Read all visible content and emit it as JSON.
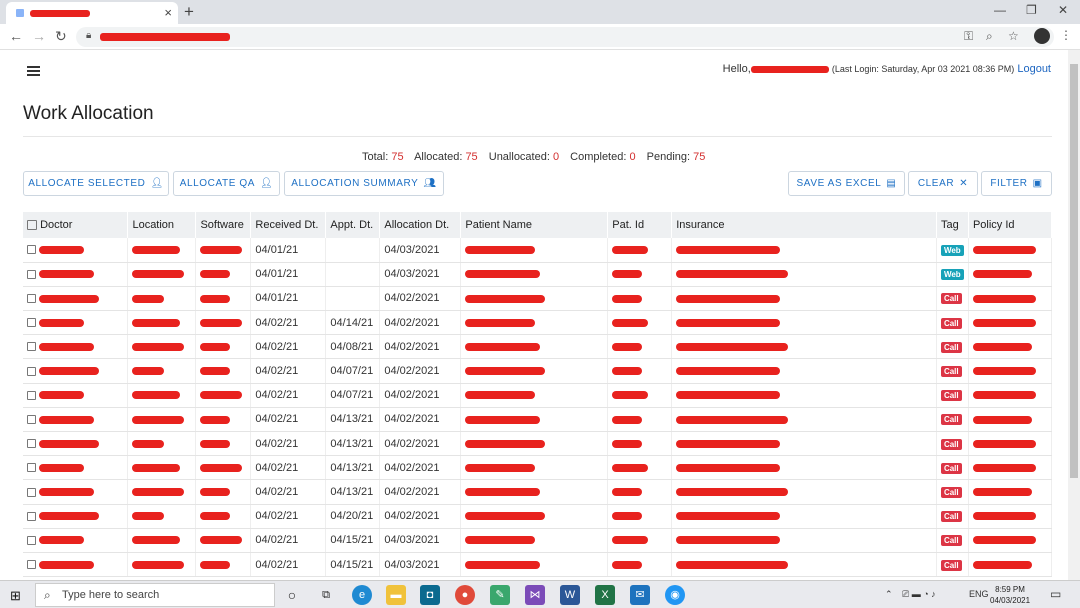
{
  "browser": {
    "new_tab": "+",
    "tab_close": "×",
    "minimize": "—",
    "restore": "❐",
    "close": "✕"
  },
  "header": {
    "greeting": "Hello,",
    "last_login": "(Last Login: Saturday, Apr 03 2021 08:36 PM)",
    "logout": "Logout"
  },
  "page": {
    "title": "Work Allocation"
  },
  "stats": {
    "total_label": "Total:",
    "total": "75",
    "allocated_label": "Allocated:",
    "allocated": "75",
    "unallocated_label": "Unallocated:",
    "unallocated": "0",
    "completed_label": "Completed:",
    "completed": "0",
    "pending_label": "Pending:",
    "pending": "75"
  },
  "buttons": {
    "allocate_selected": "ALLOCATE SELECTED",
    "allocate_qa": "ALLOCATE QA",
    "allocation_summary": "ALLOCATION SUMMARY",
    "save_excel": "SAVE AS EXCEL",
    "clear": "CLEAR",
    "filter": "FILTER"
  },
  "table": {
    "columns": [
      "Doctor",
      "Location",
      "Software",
      "Received Dt.",
      "Appt. Dt.",
      "Allocation Dt.",
      "Patient Name",
      "Pat. Id",
      "Insurance",
      "Tag",
      "Policy Id"
    ],
    "rows": [
      {
        "received": "04/01/21",
        "appt": "",
        "alloc": "04/03/2021",
        "tag": "Web"
      },
      {
        "received": "04/01/21",
        "appt": "",
        "alloc": "04/03/2021",
        "tag": "Web"
      },
      {
        "received": "04/01/21",
        "appt": "",
        "alloc": "04/02/2021",
        "tag": "Call"
      },
      {
        "received": "04/02/21",
        "appt": "04/14/21",
        "alloc": "04/02/2021",
        "tag": "Call"
      },
      {
        "received": "04/02/21",
        "appt": "04/08/21",
        "alloc": "04/02/2021",
        "tag": "Call"
      },
      {
        "received": "04/02/21",
        "appt": "04/07/21",
        "alloc": "04/02/2021",
        "tag": "Call"
      },
      {
        "received": "04/02/21",
        "appt": "04/07/21",
        "alloc": "04/02/2021",
        "tag": "Call"
      },
      {
        "received": "04/02/21",
        "appt": "04/13/21",
        "alloc": "04/02/2021",
        "tag": "Call"
      },
      {
        "received": "04/02/21",
        "appt": "04/13/21",
        "alloc": "04/02/2021",
        "tag": "Call"
      },
      {
        "received": "04/02/21",
        "appt": "04/13/21",
        "alloc": "04/02/2021",
        "tag": "Call"
      },
      {
        "received": "04/02/21",
        "appt": "04/13/21",
        "alloc": "04/02/2021",
        "tag": "Call"
      },
      {
        "received": "04/02/21",
        "appt": "04/20/21",
        "alloc": "04/02/2021",
        "tag": "Call"
      },
      {
        "received": "04/02/21",
        "appt": "04/15/21",
        "alloc": "04/03/2021",
        "tag": "Call"
      },
      {
        "received": "04/02/21",
        "appt": "04/15/21",
        "alloc": "04/03/2021",
        "tag": "Call"
      }
    ]
  },
  "taskbar": {
    "search_placeholder": "Type here to search",
    "lang": "ENG",
    "time": "8:59 PM",
    "date": "04/03/2021"
  }
}
